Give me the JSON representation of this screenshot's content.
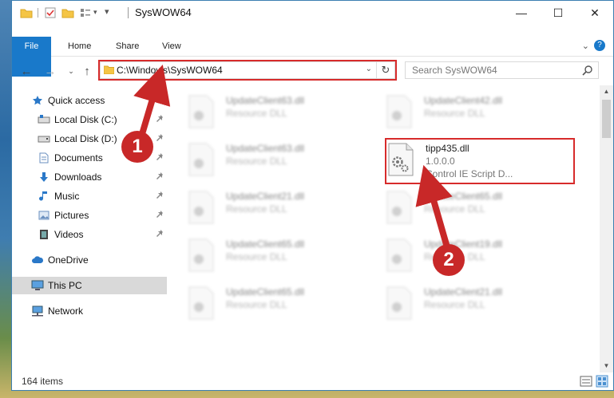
{
  "window": {
    "title": "SysWOW64",
    "minimize": "—",
    "maximize": "☐",
    "close": "✕"
  },
  "ribbon": {
    "tabs": [
      "File",
      "Home",
      "Share",
      "View"
    ],
    "help": "?"
  },
  "address": {
    "path": "C:\\Windows\\SysWOW64"
  },
  "search": {
    "placeholder": "Search SysWOW64"
  },
  "sidebar": {
    "quick_access": "Quick access",
    "items": [
      "Local Disk (C:)",
      "Local Disk (D:)",
      "Documents",
      "Downloads",
      "Music",
      "Pictures",
      "Videos"
    ],
    "onedrive": "OneDrive",
    "this_pc": "This PC",
    "network": "Network"
  },
  "files": [
    {
      "name": "UpdateClient63.dll",
      "type": "Resource DLL"
    },
    {
      "name": "UpdateClient42.dll",
      "type": "Resource DLL"
    },
    {
      "name": "UpdateClient63.dll",
      "type": "Resource DLL"
    },
    {
      "name": "tipp435.dll",
      "version": "1.0.0.0",
      "type": "Control IE Script D..."
    },
    {
      "name": "UpdateClient21.dll",
      "type": "Resource DLL"
    },
    {
      "name": "UpdateClient65.dll",
      "type": "Resource DLL"
    },
    {
      "name": "UpdateClient65.dll",
      "type": "Resource DLL"
    },
    {
      "name": "UpdateClient19.dll",
      "type": "Resource DLL"
    },
    {
      "name": "UpdateClient65.dll",
      "type": "Resource DLL"
    },
    {
      "name": "UpdateClient21.dll",
      "type": "Resource DLL"
    }
  ],
  "status": {
    "items": "164 items"
  },
  "callouts": [
    "1",
    "2"
  ],
  "colors": {
    "accent": "#1979ca",
    "highlight": "#d72b2b",
    "callout": "#c82828"
  }
}
